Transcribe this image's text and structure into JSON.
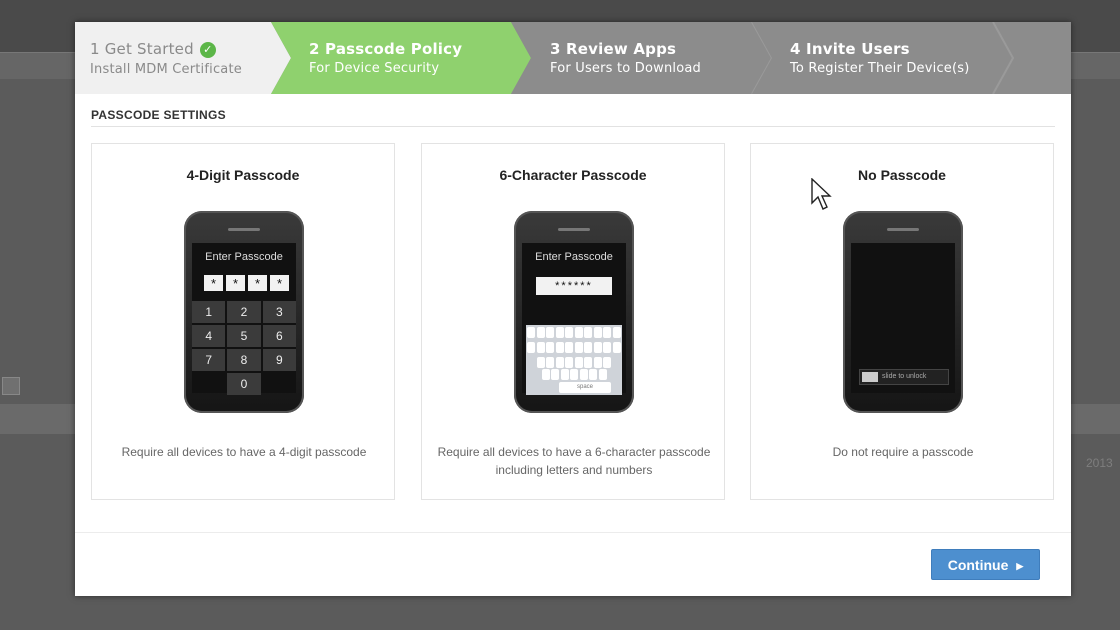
{
  "background": {
    "year_fragment": "2013"
  },
  "wizard": {
    "steps": [
      {
        "title": "1 Get Started",
        "subtitle": "Install MDM Certificate",
        "state": "complete"
      },
      {
        "title": "2 Passcode Policy",
        "subtitle": "For Device Security",
        "state": "active"
      },
      {
        "title": "3 Review Apps",
        "subtitle": "For Users to Download",
        "state": "pending"
      },
      {
        "title": "4 Invite Users",
        "subtitle": "To Register Their Device(s)",
        "state": "pending"
      }
    ]
  },
  "section": {
    "title": "PASSCODE SETTINGS"
  },
  "options": [
    {
      "title": "4-Digit Passcode",
      "description": "Require all devices to have a 4-digit passcode",
      "screen_label": "Enter Passcode",
      "digits": [
        "*",
        "*",
        "*",
        "*"
      ],
      "keys": [
        "1",
        "2",
        "3",
        "4",
        "5",
        "6",
        "7",
        "8",
        "9",
        "0"
      ]
    },
    {
      "title": "6-Character Passcode",
      "description": "Require all devices to have a 6-character passcode including letters and numbers",
      "screen_label": "Enter Passcode",
      "masked": "******",
      "space_key": "space"
    },
    {
      "title": "No Passcode",
      "description": "Do not require a passcode",
      "unlock_label": "slide to unlock"
    }
  ],
  "actions": {
    "continue_label": "Continue"
  },
  "colors": {
    "active_step": "#8fd16e",
    "pending_step": "#8c8c8c",
    "primary_button": "#4d8fcf",
    "check": "#5cb648"
  }
}
